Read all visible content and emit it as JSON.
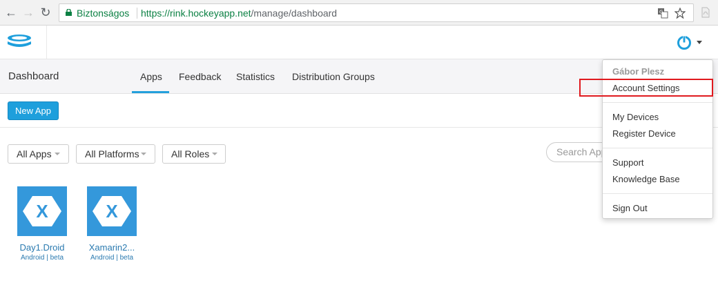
{
  "browser": {
    "secure_label": "Biztonságos",
    "url_host": "https://rink.hockeyapp.net",
    "url_path": "/manage/dashboard"
  },
  "subnav": {
    "title": "Dashboard",
    "tabs": [
      {
        "label": "Apps",
        "active": true
      },
      {
        "label": "Feedback",
        "active": false
      },
      {
        "label": "Statistics",
        "active": false
      },
      {
        "label": "Distribution Groups",
        "active": false
      }
    ]
  },
  "toolbar": {
    "new_app_label": "New App"
  },
  "filters": [
    {
      "label": "All Apps"
    },
    {
      "label": "All Platforms"
    },
    {
      "label": "All Roles"
    }
  ],
  "search": {
    "placeholder": "Search Apps"
  },
  "apps": [
    {
      "name": "Day1.Droid",
      "meta": "Android | beta",
      "icon": "xamarin-icon"
    },
    {
      "name": "Xamarin2...",
      "meta": "Android | beta",
      "icon": "xamarin-icon"
    }
  ],
  "user_menu": {
    "user_name": "Gábor Plesz",
    "items": [
      {
        "label": "Account Settings"
      },
      {
        "label": "My Devices"
      },
      {
        "label": "Register Device"
      },
      {
        "label": "Support"
      },
      {
        "label": "Knowledge Base"
      },
      {
        "label": "Sign Out"
      }
    ]
  },
  "colors": {
    "accent": "#1e9fdc",
    "secure_green": "#0b8043",
    "app_icon_bg": "#3498db",
    "highlight_red": "#e0191e"
  }
}
